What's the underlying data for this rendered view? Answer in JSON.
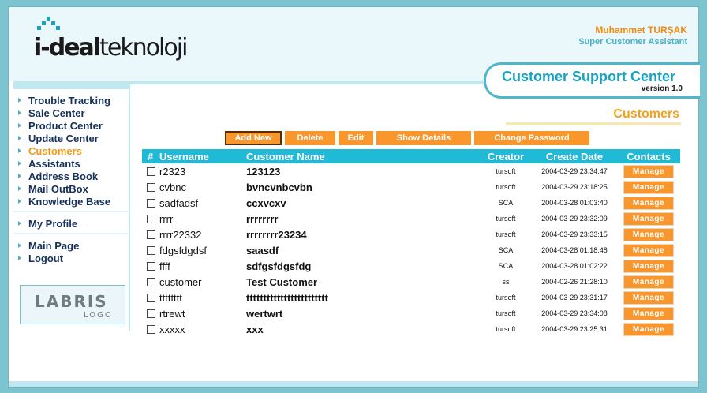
{
  "brand": {
    "logo_prefix": "i-deal",
    "logo_suffix": "teknoloji"
  },
  "user": {
    "name": "Muhammet TURŞAK",
    "role": "Super Customer Assistant"
  },
  "app": {
    "title": "Customer Support Center",
    "version": "version 1.0"
  },
  "nav": {
    "group1": [
      "Trouble Tracking",
      "Sale Center",
      "Product Center",
      "Update Center",
      "Customers",
      "Assistants",
      "Address Book",
      "Mail OutBox",
      "Knowledge Base"
    ],
    "active": "Customers",
    "group2": [
      "My Profile"
    ],
    "group3": [
      "Main Page",
      "Logout"
    ]
  },
  "sponsor": {
    "main": "LABRIS",
    "sub": "LOGO"
  },
  "section_title": "Customers",
  "toolbar": {
    "add_new": "Add New",
    "delete": "Delete",
    "edit": "Edit",
    "show_details": "Show Details",
    "change_password": "Change Password"
  },
  "table": {
    "headers": {
      "num": "#",
      "username": "Username",
      "customer_name": "Customer Name",
      "creator": "Creator",
      "create_date": "Create Date",
      "contacts": "Contacts"
    },
    "manage_label": "Manage",
    "rows": [
      {
        "username": "r2323",
        "customer_name": "123123",
        "creator": "tursoft",
        "create_date": "2004-03-29 23:34:47"
      },
      {
        "username": "cvbnc",
        "customer_name": "bvncvnbcvbn",
        "creator": "tursoft",
        "create_date": "2004-03-29 23:18:25"
      },
      {
        "username": "sadfadsf",
        "customer_name": "ccxvcxv",
        "creator": "SCA",
        "create_date": "2004-03-28 01:03:40"
      },
      {
        "username": "rrrr",
        "customer_name": "rrrrrrrr",
        "creator": "tursoft",
        "create_date": "2004-03-29 23:32:09"
      },
      {
        "username": "rrrr22332",
        "customer_name": "rrrrrrrr23234",
        "creator": "tursoft",
        "create_date": "2004-03-29 23:33:15"
      },
      {
        "username": "fdgsfdgdsf",
        "customer_name": "saasdf",
        "creator": "SCA",
        "create_date": "2004-03-28 01:18:48"
      },
      {
        "username": "ffff",
        "customer_name": "sdfgsfdgsfdg",
        "creator": "SCA",
        "create_date": "2004-03-28 01:02:22"
      },
      {
        "username": "customer",
        "customer_name": "Test Customer",
        "creator": "ss",
        "create_date": "2004-02-26 21:28:10"
      },
      {
        "username": "tttttttt",
        "customer_name": "tttttttttttttttttttttttt",
        "creator": "tursoft",
        "create_date": "2004-03-29 23:31:17"
      },
      {
        "username": "rtrewt",
        "customer_name": "wertwrt",
        "creator": "tursoft",
        "create_date": "2004-03-29 23:34:08"
      },
      {
        "username": "xxxxx",
        "customer_name": "xxx",
        "creator": "tursoft",
        "create_date": "2004-03-29 23:25:31"
      }
    ]
  },
  "colors": {
    "accent_orange": "#f9962c",
    "accent_teal": "#20b9d6",
    "nav_text": "#15305a",
    "active_nav": "#f39a14"
  }
}
